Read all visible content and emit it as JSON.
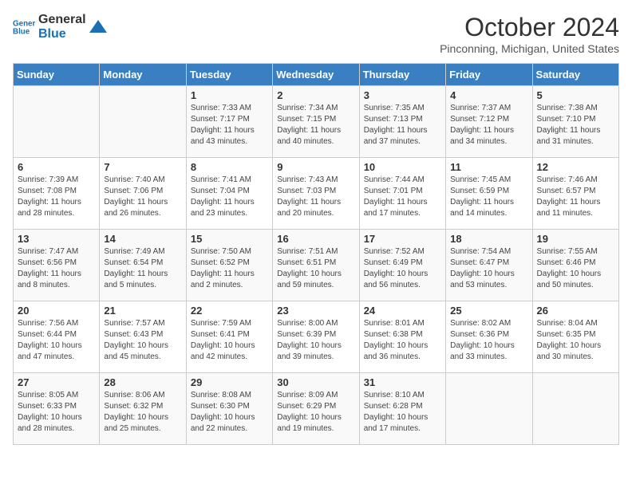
{
  "logo": {
    "line1": "General",
    "line2": "Blue"
  },
  "title": "October 2024",
  "subtitle": "Pinconning, Michigan, United States",
  "weekdays": [
    "Sunday",
    "Monday",
    "Tuesday",
    "Wednesday",
    "Thursday",
    "Friday",
    "Saturday"
  ],
  "weeks": [
    [
      {
        "day": "",
        "info": ""
      },
      {
        "day": "",
        "info": ""
      },
      {
        "day": "1",
        "info": "Sunrise: 7:33 AM\nSunset: 7:17 PM\nDaylight: 11 hours and 43 minutes."
      },
      {
        "day": "2",
        "info": "Sunrise: 7:34 AM\nSunset: 7:15 PM\nDaylight: 11 hours and 40 minutes."
      },
      {
        "day": "3",
        "info": "Sunrise: 7:35 AM\nSunset: 7:13 PM\nDaylight: 11 hours and 37 minutes."
      },
      {
        "day": "4",
        "info": "Sunrise: 7:37 AM\nSunset: 7:12 PM\nDaylight: 11 hours and 34 minutes."
      },
      {
        "day": "5",
        "info": "Sunrise: 7:38 AM\nSunset: 7:10 PM\nDaylight: 11 hours and 31 minutes."
      }
    ],
    [
      {
        "day": "6",
        "info": "Sunrise: 7:39 AM\nSunset: 7:08 PM\nDaylight: 11 hours and 28 minutes."
      },
      {
        "day": "7",
        "info": "Sunrise: 7:40 AM\nSunset: 7:06 PM\nDaylight: 11 hours and 26 minutes."
      },
      {
        "day": "8",
        "info": "Sunrise: 7:41 AM\nSunset: 7:04 PM\nDaylight: 11 hours and 23 minutes."
      },
      {
        "day": "9",
        "info": "Sunrise: 7:43 AM\nSunset: 7:03 PM\nDaylight: 11 hours and 20 minutes."
      },
      {
        "day": "10",
        "info": "Sunrise: 7:44 AM\nSunset: 7:01 PM\nDaylight: 11 hours and 17 minutes."
      },
      {
        "day": "11",
        "info": "Sunrise: 7:45 AM\nSunset: 6:59 PM\nDaylight: 11 hours and 14 minutes."
      },
      {
        "day": "12",
        "info": "Sunrise: 7:46 AM\nSunset: 6:57 PM\nDaylight: 11 hours and 11 minutes."
      }
    ],
    [
      {
        "day": "13",
        "info": "Sunrise: 7:47 AM\nSunset: 6:56 PM\nDaylight: 11 hours and 8 minutes."
      },
      {
        "day": "14",
        "info": "Sunrise: 7:49 AM\nSunset: 6:54 PM\nDaylight: 11 hours and 5 minutes."
      },
      {
        "day": "15",
        "info": "Sunrise: 7:50 AM\nSunset: 6:52 PM\nDaylight: 11 hours and 2 minutes."
      },
      {
        "day": "16",
        "info": "Sunrise: 7:51 AM\nSunset: 6:51 PM\nDaylight: 10 hours and 59 minutes."
      },
      {
        "day": "17",
        "info": "Sunrise: 7:52 AM\nSunset: 6:49 PM\nDaylight: 10 hours and 56 minutes."
      },
      {
        "day": "18",
        "info": "Sunrise: 7:54 AM\nSunset: 6:47 PM\nDaylight: 10 hours and 53 minutes."
      },
      {
        "day": "19",
        "info": "Sunrise: 7:55 AM\nSunset: 6:46 PM\nDaylight: 10 hours and 50 minutes."
      }
    ],
    [
      {
        "day": "20",
        "info": "Sunrise: 7:56 AM\nSunset: 6:44 PM\nDaylight: 10 hours and 47 minutes."
      },
      {
        "day": "21",
        "info": "Sunrise: 7:57 AM\nSunset: 6:43 PM\nDaylight: 10 hours and 45 minutes."
      },
      {
        "day": "22",
        "info": "Sunrise: 7:59 AM\nSunset: 6:41 PM\nDaylight: 10 hours and 42 minutes."
      },
      {
        "day": "23",
        "info": "Sunrise: 8:00 AM\nSunset: 6:39 PM\nDaylight: 10 hours and 39 minutes."
      },
      {
        "day": "24",
        "info": "Sunrise: 8:01 AM\nSunset: 6:38 PM\nDaylight: 10 hours and 36 minutes."
      },
      {
        "day": "25",
        "info": "Sunrise: 8:02 AM\nSunset: 6:36 PM\nDaylight: 10 hours and 33 minutes."
      },
      {
        "day": "26",
        "info": "Sunrise: 8:04 AM\nSunset: 6:35 PM\nDaylight: 10 hours and 30 minutes."
      }
    ],
    [
      {
        "day": "27",
        "info": "Sunrise: 8:05 AM\nSunset: 6:33 PM\nDaylight: 10 hours and 28 minutes."
      },
      {
        "day": "28",
        "info": "Sunrise: 8:06 AM\nSunset: 6:32 PM\nDaylight: 10 hours and 25 minutes."
      },
      {
        "day": "29",
        "info": "Sunrise: 8:08 AM\nSunset: 6:30 PM\nDaylight: 10 hours and 22 minutes."
      },
      {
        "day": "30",
        "info": "Sunrise: 8:09 AM\nSunset: 6:29 PM\nDaylight: 10 hours and 19 minutes."
      },
      {
        "day": "31",
        "info": "Sunrise: 8:10 AM\nSunset: 6:28 PM\nDaylight: 10 hours and 17 minutes."
      },
      {
        "day": "",
        "info": ""
      },
      {
        "day": "",
        "info": ""
      }
    ]
  ]
}
